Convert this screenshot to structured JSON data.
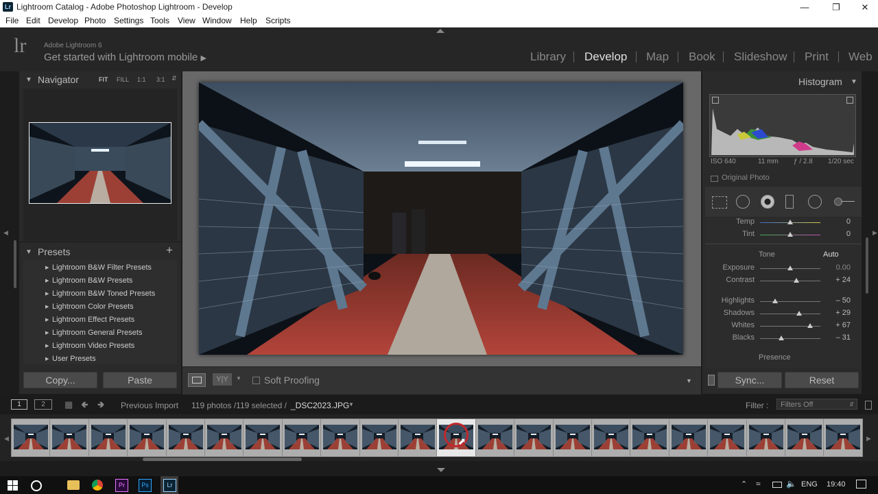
{
  "window": {
    "title": "Lightroom Catalog - Adobe Photoshop Lightroom - Develop",
    "badge": "Lr"
  },
  "menu": [
    "File",
    "Edit",
    "Develop",
    "Photo",
    "Settings",
    "Tools",
    "View",
    "Window",
    "Help",
    "Scripts"
  ],
  "identity": {
    "logo": "lr",
    "brand": "Adobe Lightroom 6",
    "mobile": "Get started with Lightroom mobile"
  },
  "modules": [
    "Library",
    "Develop",
    "Map",
    "Book",
    "Slideshow",
    "Print",
    "Web"
  ],
  "navigator": {
    "title": "Navigator",
    "zoom": [
      "FIT",
      "FILL",
      "1:1",
      "3:1"
    ]
  },
  "presets": {
    "title": "Presets",
    "items": [
      "Lightroom B&W Filter Presets",
      "Lightroom B&W Presets",
      "Lightroom B&W Toned Presets",
      "Lightroom Color Presets",
      "Lightroom Effect Presets",
      "Lightroom General Presets",
      "Lightroom Video Presets",
      "User Presets"
    ]
  },
  "left_buttons": {
    "copy": "Copy...",
    "paste": "Paste"
  },
  "toolbar": {
    "soft_proofing": "Soft Proofing"
  },
  "histogram": {
    "title": "Histogram",
    "iso": "ISO 640",
    "focal": "11 mm",
    "aperture": "ƒ / 2.8",
    "shutter": "1/20 sec",
    "original_photo": "Original Photo"
  },
  "basic": {
    "wb": [
      {
        "label": "Temp",
        "value": "0",
        "level": 0.5
      },
      {
        "label": "Tint",
        "value": "0",
        "level": 0.5
      }
    ],
    "tone_label": "Tone",
    "auto_label": "Auto",
    "tone": [
      {
        "label": "Exposure",
        "value": "0.00",
        "level": 0.5
      },
      {
        "label": "Contrast",
        "value": "+ 24",
        "level": 0.6
      }
    ],
    "presence_sliders": [
      {
        "label": "Highlights",
        "value": "– 50",
        "level": 0.25
      },
      {
        "label": "Shadows",
        "value": "+ 29",
        "level": 0.65
      },
      {
        "label": "Whites",
        "value": "+ 67",
        "level": 0.83
      },
      {
        "label": "Blacks",
        "value": "– 31",
        "level": 0.35
      }
    ],
    "presence_label": "Presence"
  },
  "right_buttons": {
    "sync": "Sync...",
    "reset": "Reset"
  },
  "filmbar": {
    "views": [
      "1",
      "2"
    ],
    "source": "Previous Import",
    "count": "119 photos /119 selected /",
    "filename": "_DSC2023.JPG",
    "filter_label": "Filter :",
    "filter_value": "Filters Off"
  },
  "filmstrip": {
    "count": 22,
    "selected_index": 11
  },
  "taskbar": {
    "lang": "ENG",
    "time": "19:40"
  },
  "colors": {
    "accent_red": "#c0282d",
    "panel": "#2a2a2a",
    "background": "#1c1c1c"
  }
}
